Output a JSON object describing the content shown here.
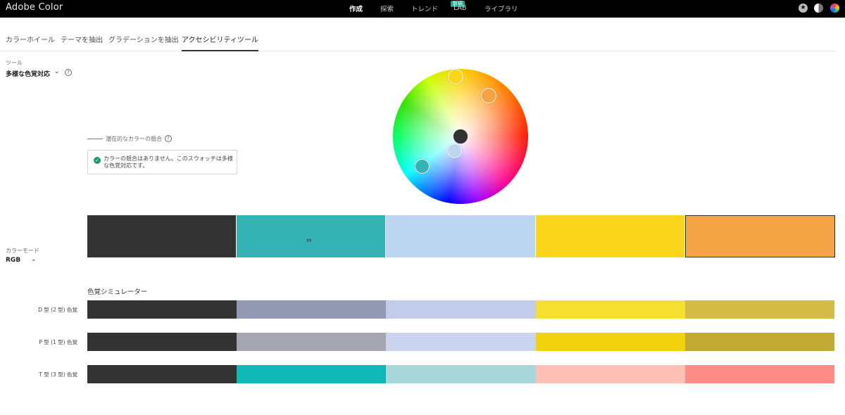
{
  "header": {
    "brand": "Adobe Color",
    "nav": [
      {
        "label": "作成",
        "active": true
      },
      {
        "label": "探索",
        "active": false
      },
      {
        "label": "トレンド",
        "active": false
      },
      {
        "label": "LAB",
        "active": false
      },
      {
        "label": "ライブラリ",
        "active": false
      }
    ],
    "badge": "新規"
  },
  "tabs": [
    {
      "label": "カラーホイール",
      "active": false
    },
    {
      "label": "テーマを抽出",
      "active": false
    },
    {
      "label": "グラデーションを抽出",
      "active": false
    },
    {
      "label": "アクセシビリティツール",
      "active": true
    }
  ],
  "tool": {
    "label": "ツール",
    "selected": "多様な色覚対応",
    "help": "?"
  },
  "conflict": {
    "label": "潜在的なカラーの競合",
    "help": "?",
    "message": "カラーの競合はありません。このスウォッチは多様な色覚対応です。"
  },
  "color_mode": {
    "label": "カラーモード",
    "selected": "RGB"
  },
  "swatches": [
    "#333333",
    "#35b3b5",
    "#bcd5f0",
    "#fad51b",
    "#f4a444"
  ],
  "adjust_icon": "⧦",
  "simulator": {
    "title": "色覚シミュレーター",
    "rows": [
      {
        "label": "D 型 (2 型) 色覚",
        "colors": [
          "#333333",
          "#9399b3",
          "#c2cbea",
          "#f5e031",
          "#d2bc45"
        ]
      },
      {
        "label": "P 型 (1 型) 色覚",
        "colors": [
          "#333333",
          "#a6a7b3",
          "#cbd5ef",
          "#f0d30d",
          "#c2a934"
        ]
      },
      {
        "label": "T 型 (3 型) 色覚",
        "colors": [
          "#333333",
          "#12b8b5",
          "#a9d8dc",
          "#fdc0b4",
          "#fd8c87"
        ]
      }
    ]
  }
}
